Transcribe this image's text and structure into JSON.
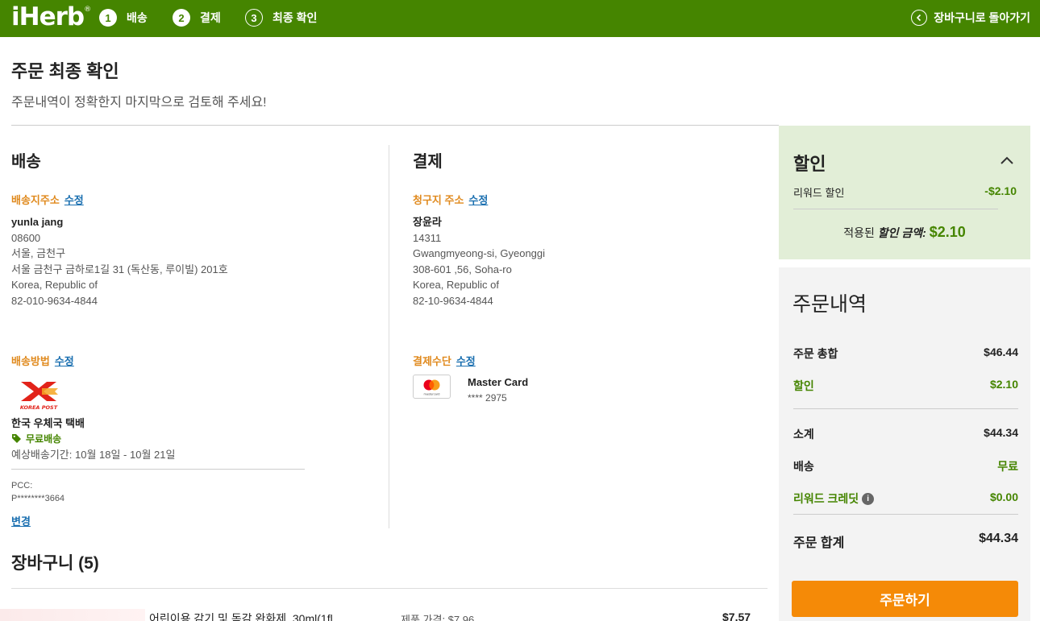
{
  "header": {
    "logo": "iHerb",
    "logo_mark": "®",
    "steps": [
      {
        "num": "1",
        "label": "배송"
      },
      {
        "num": "2",
        "label": "결제"
      },
      {
        "num": "3",
        "label": "최종 확인"
      }
    ],
    "back_label": "장바구니로 돌아가기"
  },
  "page": {
    "title": "주문 최종 확인",
    "subtitle": "주문내역이 정확한지 마지막으로 검토해 주세요!"
  },
  "shipping": {
    "title": "배송",
    "address_label": "배송지주소",
    "edit_label": "수정",
    "address": [
      "yunla jang",
      "08600",
      "서울, 금천구",
      "서울 금천구 금하로1길 31 (독산동, 루이빌) 201호",
      "Korea, Republic of",
      "82-010-9634-4844"
    ],
    "method_label": "배송방법",
    "carrier_logo_text": "KOREA POST",
    "carrier": "한국 우체국 택배",
    "free_label": "무료배송",
    "estimate": "예상배송기간: 10월 18일 - 10월 21일",
    "pcc_label": "PCC:",
    "pcc_value": "P********3664",
    "change_label": "변경"
  },
  "payment": {
    "title": "결제",
    "billing_label": "청구지 주소",
    "edit_label": "수정",
    "address": [
      "장윤라",
      "14311",
      "Gwangmyeong-si, Gyeonggi",
      "308-601 ,56, Soha-ro",
      "Korea, Republic of",
      "82-10-9634-4844"
    ],
    "method_label": "결제수단",
    "card_name": "Master Card",
    "card_brand_text": "mastercard",
    "card_number": "**** 2975"
  },
  "cart": {
    "title": "장바구니 (5)",
    "first_item": {
      "name": "어린이용 감기 및 독감 완화제, 30ml(1fl",
      "price_label": "제품 가격: $7.96",
      "total": "$7.57"
    }
  },
  "discount": {
    "title": "할인",
    "rewards_label": "리워드 할인",
    "rewards_value": "-$2.10",
    "applied_prefix": "적용된 ",
    "applied_em": "할인 금액",
    "applied_colon": ":",
    "applied_amount": "$2.10"
  },
  "summary": {
    "title": "주문내역",
    "subtotal_label": "주문 총합",
    "subtotal_value": "$46.44",
    "discount_label": "할인",
    "discount_value": "$2.10",
    "net_label": "소계",
    "net_value": "$44.34",
    "shipping_label": "배송",
    "shipping_value": "무료",
    "credit_label": "리워드 크레딧",
    "credit_value": "$0.00",
    "total_label": "주문 합계",
    "total_value": "$44.34",
    "order_button": "주문하기"
  },
  "colors": {
    "brand_green": "#458500",
    "accent_orange": "#f58a07",
    "label_orange": "#e08a1e",
    "link_blue": "#1a6fb0"
  }
}
